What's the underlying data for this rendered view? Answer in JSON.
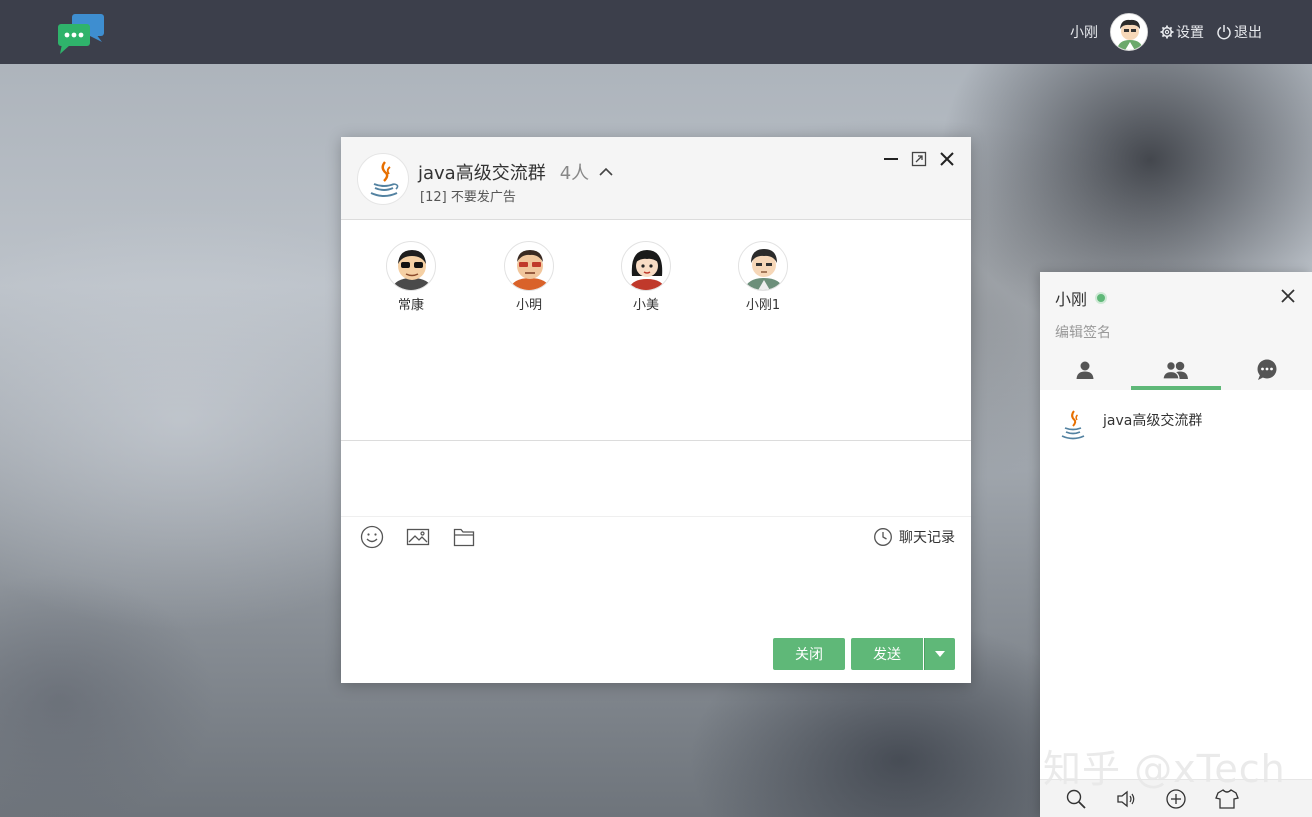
{
  "topbar": {
    "username": "小刚",
    "settings_label": "设置",
    "logout_label": "退出"
  },
  "chat": {
    "group_name": "java高级交流群",
    "member_count": "4人",
    "notice": "[12] 不要发广告",
    "members": [
      {
        "name": "常康",
        "avatar": "sunglasses-avatar"
      },
      {
        "name": "小明",
        "avatar": "red-glasses-avatar"
      },
      {
        "name": "小美",
        "avatar": "girl-avatar"
      },
      {
        "name": "小刚1",
        "avatar": "boy-avatar"
      }
    ],
    "history_label": "聊天记录",
    "close_label": "关闭",
    "send_label": "发送",
    "icons": [
      "smile-icon",
      "image-icon",
      "folder-icon",
      "clock-icon"
    ]
  },
  "panel": {
    "username": "小刚",
    "status_color": "#5fb878",
    "sign_placeholder": "编辑签名",
    "tabs": [
      "friends-tab",
      "groups-tab",
      "history-tab"
    ],
    "active_tab": "groups-tab",
    "groups": [
      {
        "name": "java高级交流群"
      }
    ],
    "footer_icons": [
      "search-icon",
      "sound-icon",
      "add-icon",
      "skin-icon"
    ]
  },
  "watermark": "知乎 @xTech",
  "colors": {
    "accent": "#5fb878",
    "topbar": "#3c3f4b"
  }
}
